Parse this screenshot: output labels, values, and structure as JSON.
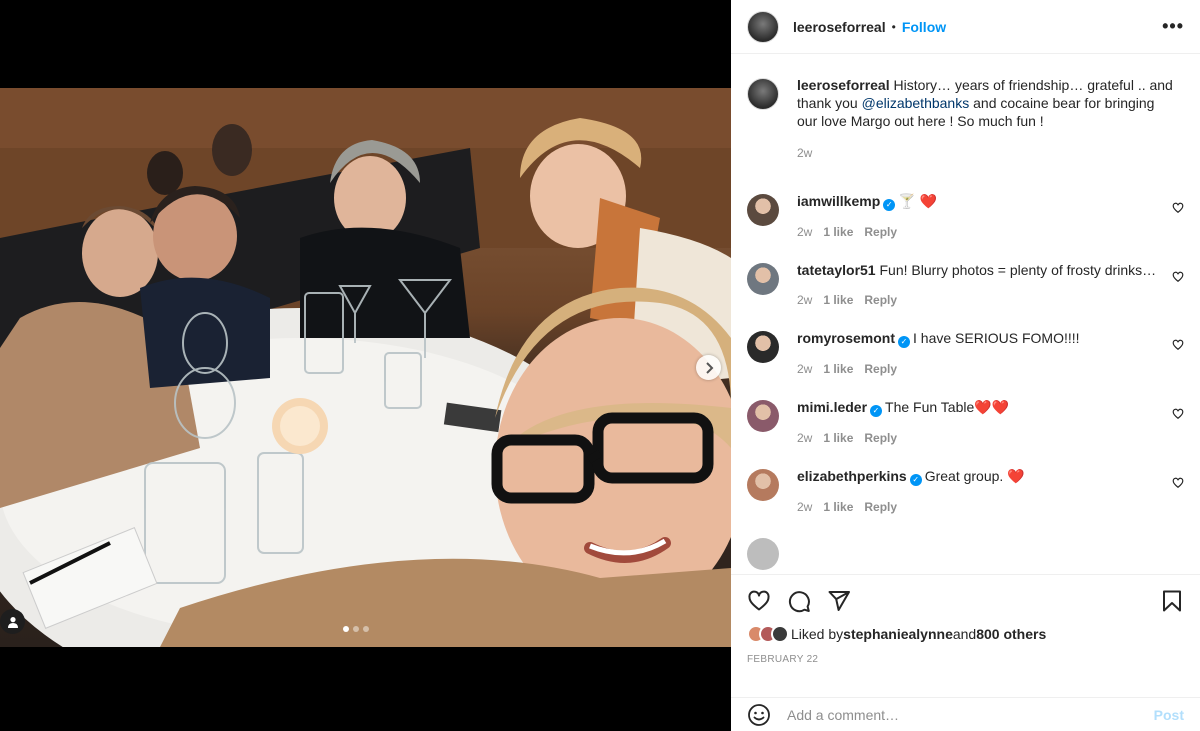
{
  "post": {
    "author": "leeroseforreal",
    "follow_label": "Follow",
    "separator": "•",
    "more_icon": "more-horizontal-icon"
  },
  "caption": {
    "username": "leeroseforreal",
    "text_before": "History… years of friendship… grateful .. and thank you ",
    "mention": "@elizabethbanks",
    "text_after": " and cocaine bear for bringing our love Margo out here ! So much fun !",
    "time": "2w"
  },
  "comments": [
    {
      "username": "iamwillkemp",
      "verified": true,
      "text": "🍸 ❤️",
      "time": "2w",
      "likes": "1 like",
      "reply": "Reply",
      "avatar_color": "#5b4a3f"
    },
    {
      "username": "tatetaylor51",
      "verified": false,
      "text": "Fun! Blurry photos = plenty of frosty drinks…",
      "time": "2w",
      "likes": "1 like",
      "reply": "Reply",
      "avatar_color": "#6f7780"
    },
    {
      "username": "romyrosemont",
      "verified": true,
      "text": "I have SERIOUS FOMO!!!!",
      "time": "2w",
      "likes": "1 like",
      "reply": "Reply",
      "avatar_color": "#2a2a2a"
    },
    {
      "username": "mimi.leder",
      "verified": true,
      "text": "The Fun Table❤️❤️",
      "time": "2w",
      "likes": "1 like",
      "reply": "Reply",
      "avatar_color": "#8a5a6a"
    },
    {
      "username": "elizabethperkins",
      "verified": true,
      "text": "Great group. ❤️",
      "time": "2w",
      "likes": "1 like",
      "reply": "Reply",
      "avatar_color": "#b57a5e"
    }
  ],
  "likes": {
    "prefix": "Liked by ",
    "user": "stephaniealynne",
    "and": " and ",
    "others": "800 others"
  },
  "date": "February 22",
  "add_comment": {
    "placeholder": "Add a comment…",
    "post_label": "Post"
  },
  "media": {
    "carousel_position": 1,
    "carousel_count": 3
  }
}
